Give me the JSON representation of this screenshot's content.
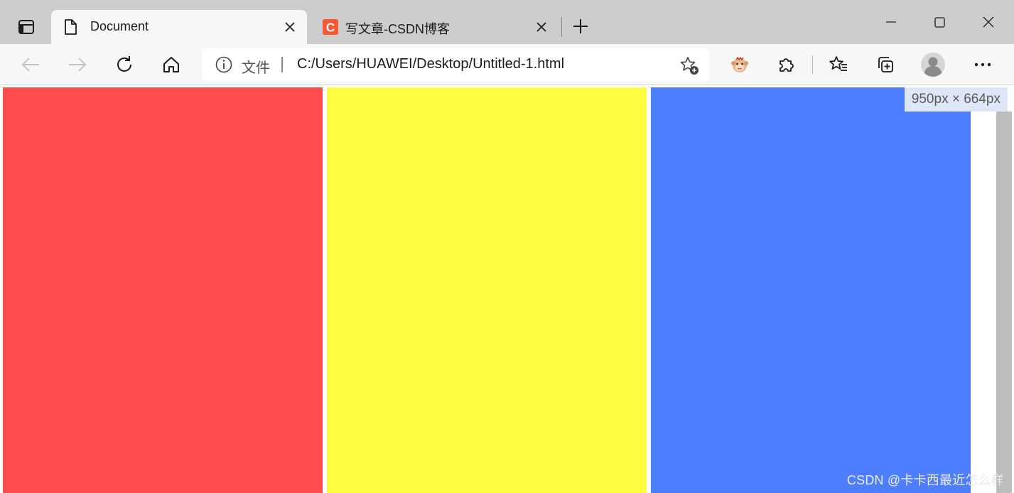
{
  "browser": {
    "tabs": [
      {
        "title": "Document",
        "favicon": "document-icon",
        "active": true
      },
      {
        "title": "写文章-CSDN博客",
        "favicon": "csdn-logo-icon",
        "favicon_letter": "C",
        "favicon_color": "#fc5531",
        "active": false
      }
    ],
    "new_tab_icon": "plus-icon",
    "window_controls": [
      "minimize-icon",
      "maximize-icon",
      "close-icon"
    ]
  },
  "toolbar": {
    "buttons": [
      "back-arrow-icon",
      "forward-arrow-icon",
      "refresh-icon",
      "home-icon"
    ],
    "address": {
      "scheme_label": "文件",
      "url": "C:/Users/HUAWEI/Desktop/Untitled-1.html"
    },
    "right_icons": [
      "add-favorite-icon",
      "extension-monkey-icon",
      "puzzle-extensions-icon",
      "favorites-icon",
      "collections-icon",
      "profile-avatar-icon",
      "more-menu-icon"
    ]
  },
  "page": {
    "columns": [
      {
        "name": "red",
        "color": "#ff4d4d"
      },
      {
        "name": "yellow",
        "color": "#fdfd42"
      },
      {
        "name": "blue",
        "color": "#4d7eff"
      }
    ],
    "dimensions_overlay": "950px × 664px",
    "watermark": "CSDN @卡卡西最近怎么样"
  },
  "colors": {
    "tabstrip": "#cdcdcd",
    "toolbar": "#f7f7f7",
    "overlay_bg": "#dde7f8"
  }
}
